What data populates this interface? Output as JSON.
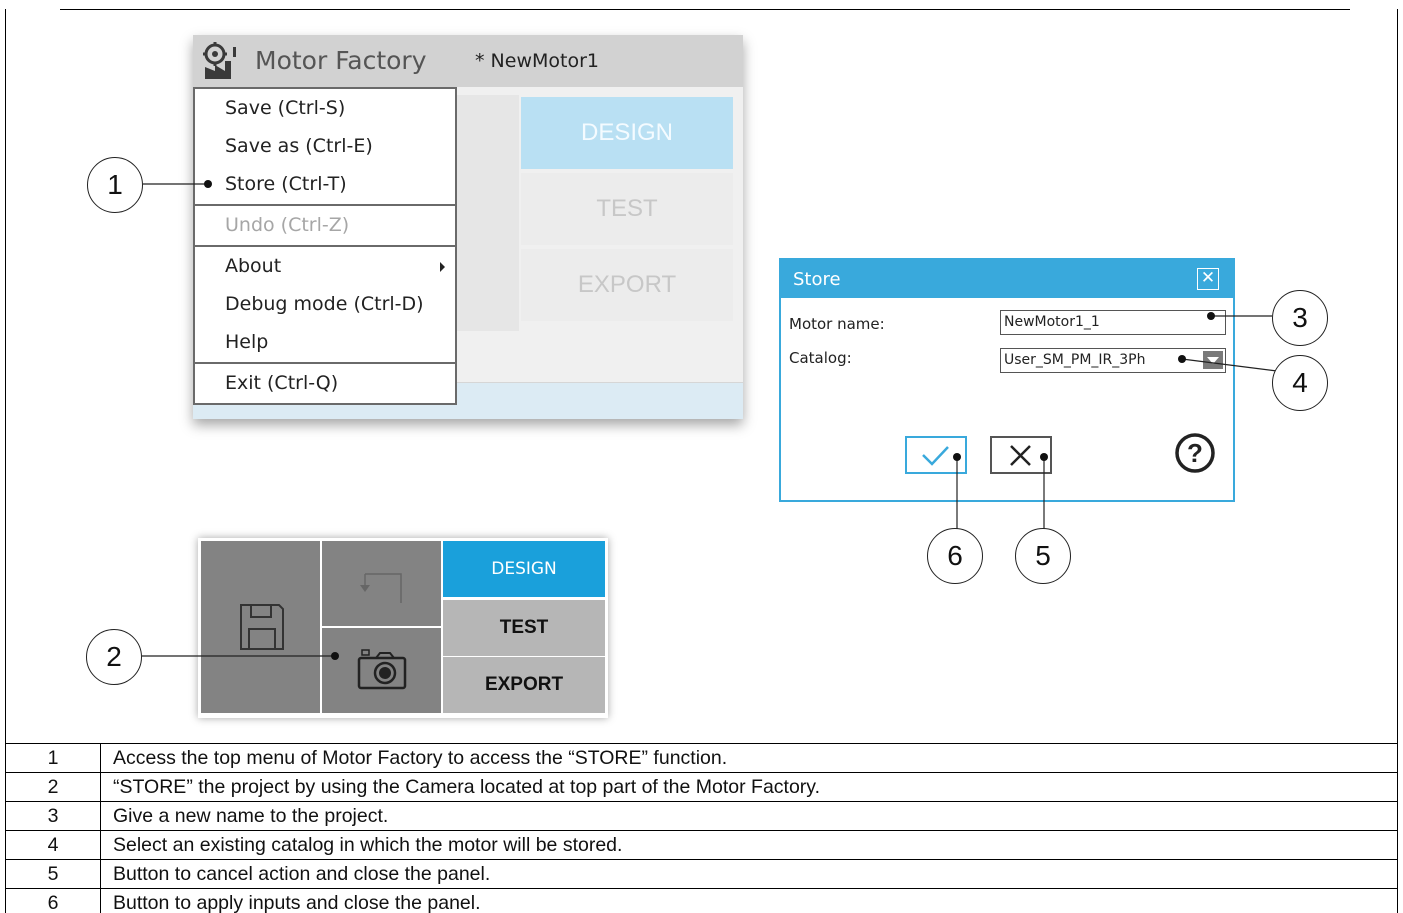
{
  "app": {
    "name": "Motor Factory",
    "file": "* NewMotor1",
    "logo_icon": "factory-gear-icon",
    "menu": {
      "save": "Save (Ctrl-S)",
      "save_as": "Save as (Ctrl-E)",
      "store": "Store (Ctrl-T)",
      "undo": "Undo (Ctrl-Z)",
      "about": "About",
      "debug": "Debug mode (Ctrl-D)",
      "help": "Help",
      "exit": "Exit (Ctrl-Q)"
    },
    "nav": {
      "design": "DESIGN",
      "test": "TEST",
      "export": "EXPORT"
    }
  },
  "dialog": {
    "title": "Store",
    "close_icon": "close-box-icon",
    "motor_name_label": "Motor name:",
    "motor_name_value": "NewMotor1_1",
    "catalog_label": "Catalog:",
    "catalog_value": "User_SM_PM_IR_3Ph",
    "ok_icon": "checkmark-icon",
    "cancel_icon": "x-icon",
    "help_icon": "help-circle-icon"
  },
  "toolbar": {
    "design": "DESIGN",
    "test": "TEST",
    "export": "EXPORT",
    "icons": [
      "save-disk-icon",
      "undo-arrow-icon",
      "camera-icon"
    ]
  },
  "callouts": {
    "c1": "1",
    "c2": "2",
    "c3": "3",
    "c4": "4",
    "c5": "5",
    "c6": "6"
  },
  "legend": [
    {
      "num": "1",
      "text": "Access the top menu of Motor Factory to access the “STORE” function."
    },
    {
      "num": "2",
      "text": "“STORE” the project by using the Camera located at top part of the Motor Factory."
    },
    {
      "num": "3",
      "text": "Give a new name to the project."
    },
    {
      "num": "4",
      "text": "Select an existing catalog in which the motor will be stored."
    },
    {
      "num": "5",
      "text": "Button to cancel action and close the panel."
    },
    {
      "num": "6",
      "text": "Button to apply inputs and close the panel."
    }
  ],
  "colors": {
    "accent": "#1aa0db",
    "dialog": "#39a9dc",
    "tile": "#838383"
  }
}
